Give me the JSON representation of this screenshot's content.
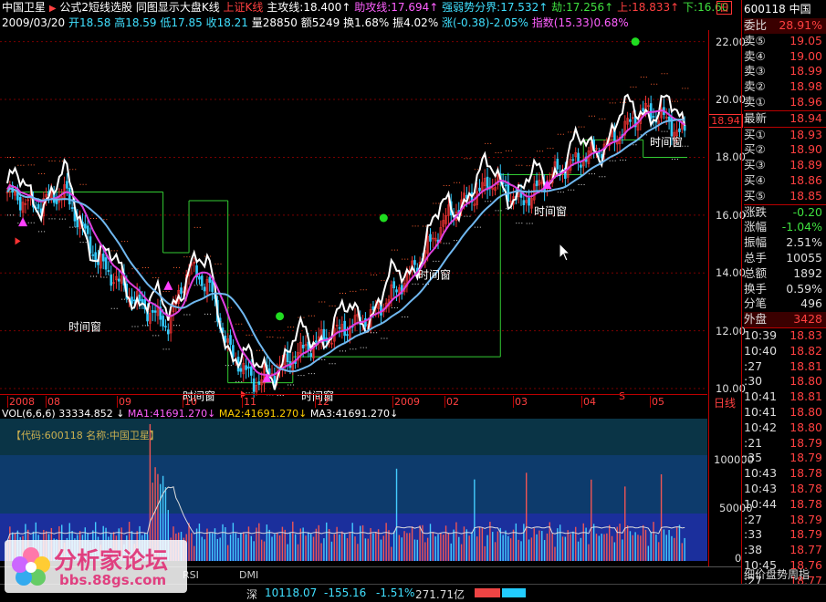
{
  "header": {
    "stock_name": "中国卫星",
    "formula": "公式2短线选股",
    "same_chart": "同图显示大盘K线",
    "index_label": "上证K线",
    "zhugong_label": "主攻线",
    "zhugong_value": "18.400",
    "zhugong_arrow": "↑",
    "zhugong2_label": "助攻线",
    "zhugong2_value": "17.694",
    "qrsfj_label": "强弱势分界",
    "qrsfj_value": "17.532",
    "jie_label": "劫",
    "jie_value": "17.256",
    "shang_label": "上",
    "shang_value": "18.833",
    "xia_label": "下",
    "xia_value": "16.60",
    "ri_label": "日"
  },
  "ohlc": {
    "date": "2009/03/20",
    "open": "开18.58",
    "high": "高18.59",
    "low": "低17.85",
    "close": "收18.21",
    "volume": "量28850",
    "amount": "额5249",
    "turnover": "换1.68%",
    "amplitude": "振4.02%",
    "change": "涨(-0.38)-2.05%",
    "index_label": "指数",
    "index_value": "(15.33)0.68%"
  },
  "chart_data": {
    "type": "line",
    "ylim": [
      9.4,
      22.4
    ],
    "y_ticks": [
      "22.00",
      "20.00",
      "18.00",
      "16.00",
      "14.00",
      "12.00",
      "10.00"
    ],
    "current_price_tag": "18.94",
    "x_labels": [
      "2008",
      "08",
      "09",
      "10",
      "11",
      "12",
      "2009",
      "02",
      "03",
      "04",
      "05"
    ],
    "period_label": "日线",
    "annotations": [
      "时间窗",
      "时间窗",
      "时间窗",
      "时间窗",
      "时间窗",
      "时间窗"
    ],
    "s_marker": "S"
  },
  "volume": {
    "title": "VOL(6,6,6)",
    "vol": "33334.852",
    "ma1_label": "MA1",
    "ma1": "41691.270",
    "ma2_label": "MA2",
    "ma2": "41691.270",
    "ma3_label": "MA3",
    "ma3": "41691.270",
    "code_label": "【代码:600118 名称:中国卫星】",
    "y_ticks": [
      "100000",
      "50000",
      "0"
    ]
  },
  "quote_panel": {
    "code": "600118",
    "name": "中国",
    "weibi_label": "委比",
    "weibi": "28.91%",
    "asks": [
      {
        "label": "卖⑤",
        "price": "19.05"
      },
      {
        "label": "卖④",
        "price": "19.00"
      },
      {
        "label": "卖③",
        "price": "18.99"
      },
      {
        "label": "卖②",
        "price": "18.98"
      },
      {
        "label": "卖①",
        "price": "18.96"
      }
    ],
    "latest_label": "最新",
    "latest": "18.94",
    "bids": [
      {
        "label": "买①",
        "price": "18.93"
      },
      {
        "label": "买②",
        "price": "18.90"
      },
      {
        "label": "买③",
        "price": "18.89"
      },
      {
        "label": "买④",
        "price": "18.86"
      },
      {
        "label": "买⑤",
        "price": "18.85"
      }
    ],
    "stats": [
      {
        "label": "涨跌",
        "value": "-0.20"
      },
      {
        "label": "涨幅",
        "value": "-1.04%"
      },
      {
        "label": "振幅",
        "value": "2.51%"
      },
      {
        "label": "总手",
        "value": "10055"
      },
      {
        "label": "总额",
        "value": "1892"
      },
      {
        "label": "换手",
        "value": "0.59%"
      },
      {
        "label": "分笔",
        "value": "496"
      },
      {
        "label": "外盘",
        "value": "3428"
      }
    ],
    "ticks": [
      {
        "time": "10:39",
        "price": "18.83"
      },
      {
        "time": "10:40",
        "price": "18.82"
      },
      {
        "time": ":27",
        "price": "18.81"
      },
      {
        "time": ":30",
        "price": "18.80"
      },
      {
        "time": "10:41",
        "price": "18.81"
      },
      {
        "time": "10:41",
        "price": "18.80"
      },
      {
        "time": "10:42",
        "price": "18.80"
      },
      {
        "time": ":21",
        "price": "18.79"
      },
      {
        "time": ":35",
        "price": "18.79"
      },
      {
        "time": "10:43",
        "price": "18.78"
      },
      {
        "time": "10:43",
        "price": "18.78"
      },
      {
        "time": "10:44",
        "price": "18.78"
      },
      {
        "time": ":27",
        "price": "18.79"
      },
      {
        "time": ":33",
        "price": "18.79"
      },
      {
        "time": ":38",
        "price": "18.77"
      },
      {
        "time": "10:45",
        "price": "18.76"
      },
      {
        "time": ":27",
        "price": "18.77"
      }
    ],
    "footer": "细价盘势周指"
  },
  "bottom_bar": {
    "tabs": [
      "RSI",
      "DMI"
    ],
    "market": "深",
    "index": "10118.07",
    "change": "-155.16",
    "pct": "-1.51%",
    "amount": "271.71亿"
  },
  "watermark": {
    "text": "分析家论坛",
    "url": "bbs.88gs.com"
  }
}
